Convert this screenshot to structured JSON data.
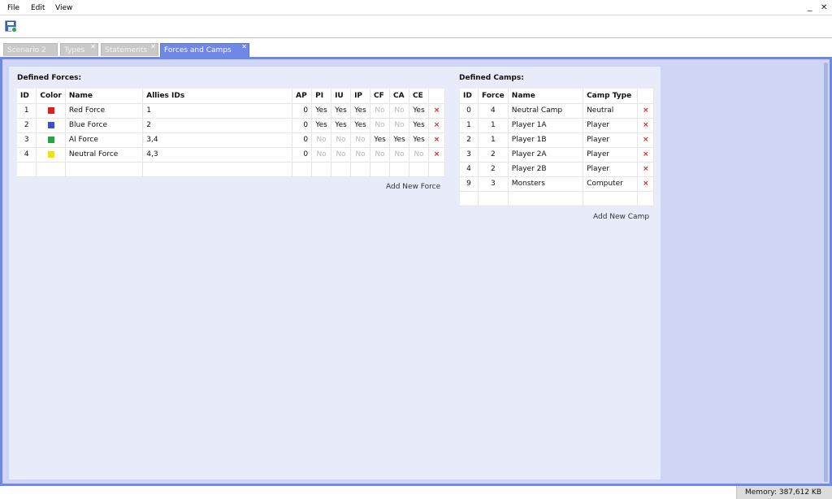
{
  "menu": {
    "file": "File",
    "edit": "Edit",
    "view": "View"
  },
  "window": {
    "minimize": "_",
    "close": "✕"
  },
  "tabs": [
    {
      "label": "Scenario 2"
    },
    {
      "label": "Types"
    },
    {
      "label": "Statements"
    },
    {
      "label": "Forces and Camps"
    }
  ],
  "forces": {
    "title": "Defined Forces:",
    "headers": [
      "ID",
      "Color",
      "Name",
      "Allies IDs",
      "AP",
      "PI",
      "IU",
      "IP",
      "CF",
      "CA",
      "CE",
      ""
    ],
    "rows": [
      {
        "id": "1",
        "color": "#e21b1b",
        "name": "Red Force",
        "allies": "1",
        "ap": "0",
        "pi": "Yes",
        "iu": "Yes",
        "ip": "Yes",
        "cf": "No",
        "ca": "No",
        "ce": "Yes",
        "del": "×"
      },
      {
        "id": "2",
        "color": "#3a4fd8",
        "name": "Blue Force",
        "allies": "2",
        "ap": "0",
        "pi": "Yes",
        "iu": "Yes",
        "ip": "Yes",
        "cf": "No",
        "ca": "No",
        "ce": "Yes",
        "del": "×"
      },
      {
        "id": "3",
        "color": "#22a83a",
        "name": "AI Force",
        "allies": "3,4",
        "ap": "0",
        "pi": "No",
        "iu": "No",
        "ip": "No",
        "cf": "Yes",
        "ca": "Yes",
        "ce": "Yes",
        "del": "×"
      },
      {
        "id": "4",
        "color": "#f2e400",
        "name": "Neutral Force",
        "allies": "4,3",
        "ap": "0",
        "pi": "No",
        "iu": "No",
        "ip": "No",
        "cf": "No",
        "ca": "No",
        "ce": "No",
        "del": "×"
      }
    ],
    "add_label": "Add New Force"
  },
  "camps": {
    "title": "Defined Camps:",
    "headers": [
      "ID",
      "Force",
      "Name",
      "Camp Type",
      ""
    ],
    "rows": [
      {
        "id": "0",
        "force": "4",
        "name": "Neutral Camp",
        "type": "Neutral",
        "del": "×"
      },
      {
        "id": "1",
        "force": "1",
        "name": "Player 1A",
        "type": "Player",
        "del": "×"
      },
      {
        "id": "2",
        "force": "1",
        "name": "Player 1B",
        "type": "Player",
        "del": "×"
      },
      {
        "id": "3",
        "force": "2",
        "name": "Player 2A",
        "type": "Player",
        "del": "×"
      },
      {
        "id": "4",
        "force": "2",
        "name": "Player 2B",
        "type": "Player",
        "del": "×"
      },
      {
        "id": "9",
        "force": "3",
        "name": "Monsters",
        "type": "Computer",
        "del": "×"
      }
    ],
    "add_label": "Add New Camp"
  },
  "status": {
    "memory": "Memory: 387,612 KB"
  }
}
